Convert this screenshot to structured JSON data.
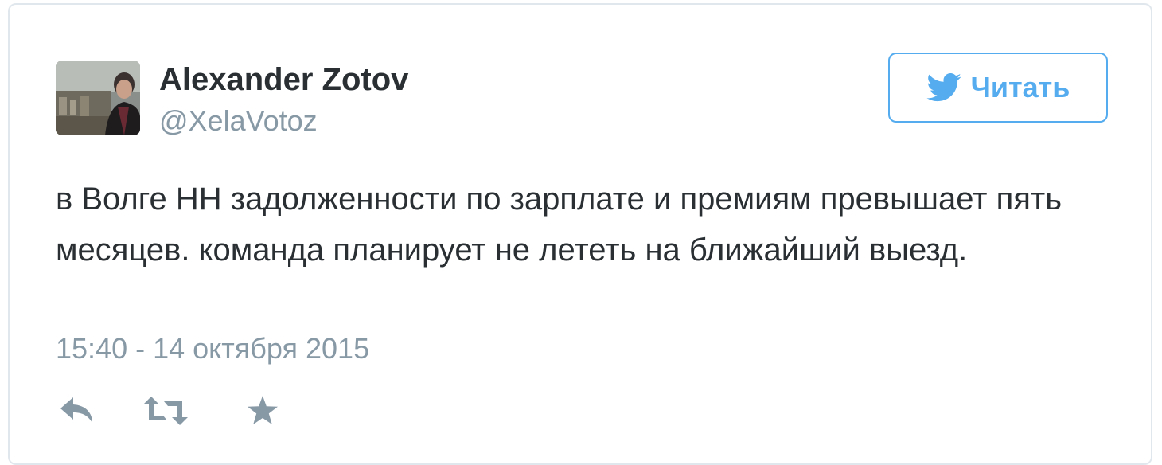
{
  "author": {
    "name": "Alexander Zotov",
    "handle": "@XelaVotoz"
  },
  "follow_button": {
    "label": "Читать",
    "icon": "twitter-bird-icon"
  },
  "tweet": {
    "text": "в Волге НН задолженности по зарплате и премиям превышает пять месяцев. команда планирует не лететь на ближайший выезд.",
    "timestamp": "15:40 - 14 октября 2015"
  },
  "actions": [
    {
      "name": "reply",
      "icon": "reply-icon"
    },
    {
      "name": "retweet",
      "icon": "retweet-icon"
    },
    {
      "name": "favorite",
      "icon": "star-icon"
    }
  ],
  "colors": {
    "accent": "#55acee",
    "text": "#292f33",
    "muted": "#8899a6",
    "border": "#e1e8ed"
  }
}
